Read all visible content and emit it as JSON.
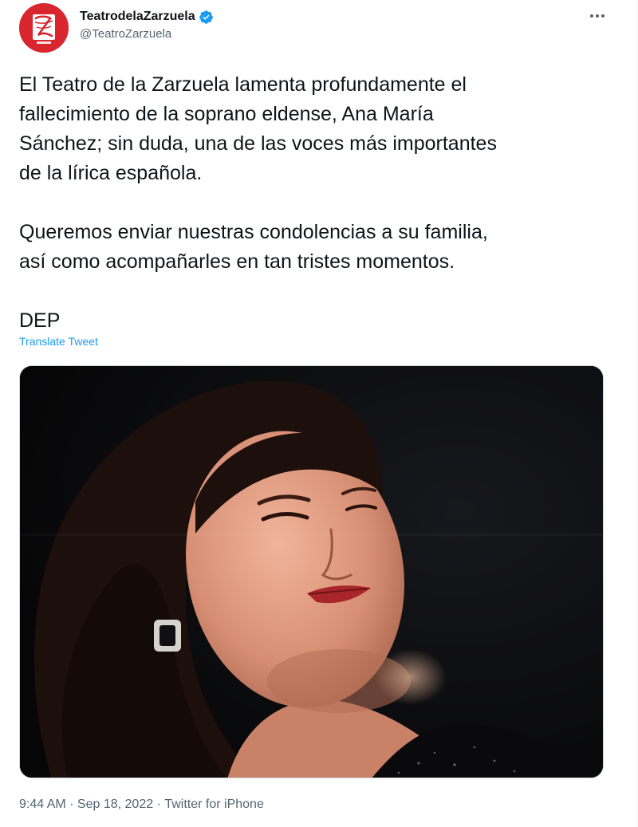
{
  "account": {
    "display_name": "TeatrodelaZarzuela",
    "handle": "@TeatroZarzuela",
    "verified": true,
    "avatar_icon": "zarzuela-logo-icon"
  },
  "tweet": {
    "text": "El Teatro de la Zarzuela lamenta profundamente el\nfallecimiento de la soprano eldense, Ana María\nSánchez; sin duda, una de las voces más importantes\nde la lírica española.\n\nQueremos enviar nuestras condolencias a su familia,\nasí como acompañarles en tan tristes momentos.\n\nDEP",
    "translate_label": "Translate Tweet"
  },
  "meta": {
    "time": "9:44 AM",
    "separator": " · ",
    "date": "Sep 18, 2022",
    "source": "Twitter for iPhone"
  },
  "colors": {
    "link": "#1d9bf0",
    "secondary_text": "#536471",
    "primary_text": "#0f1419",
    "avatar_bg": "#d9252e",
    "verified": "#1d9bf0"
  },
  "icons": [
    "zarzuela-logo-icon",
    "verified-badge-icon",
    "more-options-icon"
  ]
}
